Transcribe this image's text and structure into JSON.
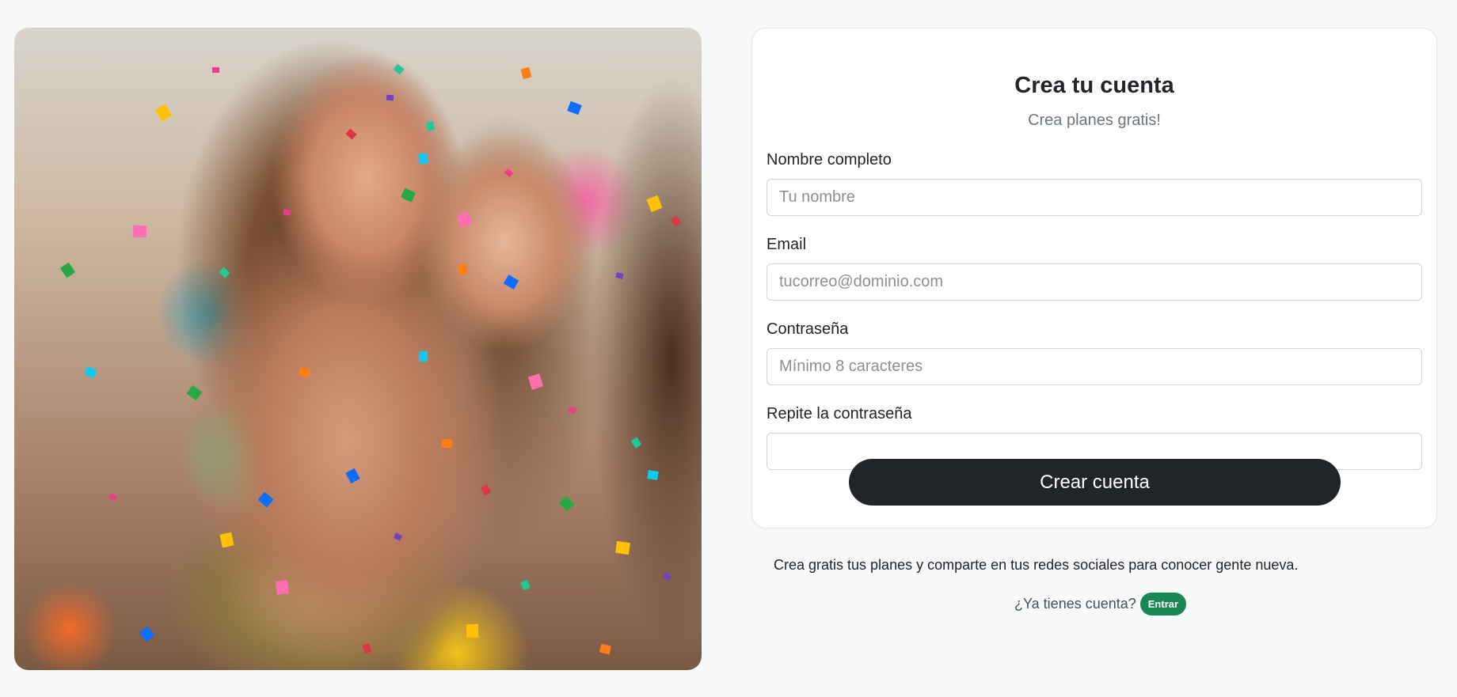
{
  "hero_image": {
    "alt": "",
    "confetti_colors": [
      "#e83e8c",
      "#20c997",
      "#fd7e14",
      "#0d6efd",
      "#ffc107",
      "#6f42c1",
      "#dc3545",
      "#0dcaf0",
      "#28a745",
      "#ff6fb0"
    ]
  },
  "form": {
    "title": "Crea tu cuenta",
    "subtitle": "Crea planes gratis!",
    "fields": {
      "name": {
        "label": "Nombre completo",
        "placeholder": "Tu nombre",
        "value": ""
      },
      "email": {
        "label": "Email",
        "placeholder": "tucorreo@dominio.com",
        "value": ""
      },
      "password": {
        "label": "Contraseña",
        "placeholder": "Mínimo 8 caracteres",
        "value": ""
      },
      "password_repeat": {
        "label": "Repite la contraseña",
        "placeholder": "",
        "value": ""
      }
    },
    "submit_label": "Crear cuenta"
  },
  "footer": {
    "promo_text": "Crea gratis tus planes y comparte en tus redes sociales para conocer gente nueva.",
    "login_question": "¿Ya tienes cuenta?",
    "login_button": "Entrar"
  },
  "colors": {
    "primary_dark": "#212529",
    "success": "#198754",
    "muted": "#6c757d",
    "background": "#f8f9fa"
  }
}
